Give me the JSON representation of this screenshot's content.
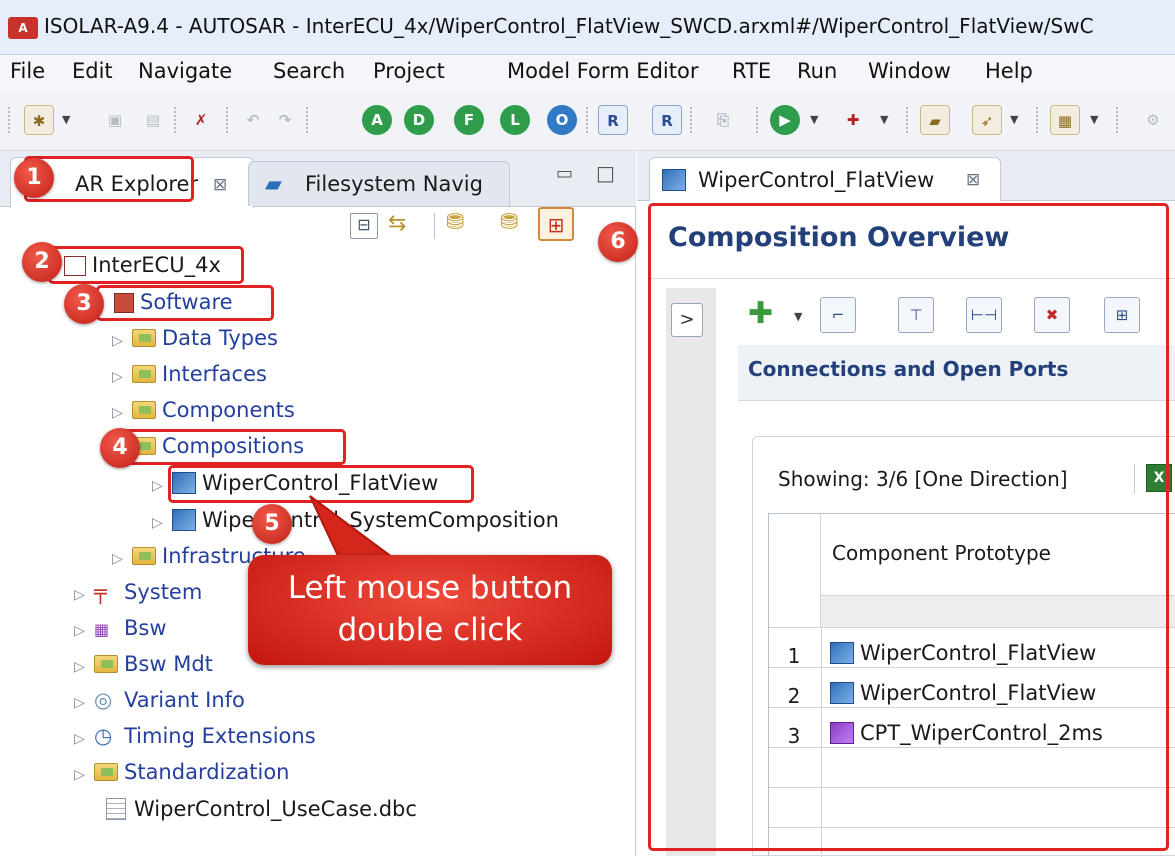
{
  "window": {
    "title": "ISOLAR-A9.4 - AUTOSAR - InterECU_4x/WiperControl_FlatView_SWCD.arxml#/WiperControl_FlatView/SwC",
    "app_icon_label": "A"
  },
  "menu": [
    "File",
    "Edit",
    "Navigate",
    "Search",
    "Project",
    "Model Form Editor",
    "RTE",
    "Run",
    "Window",
    "Help"
  ],
  "toolbar": {
    "circle_buttons": [
      "A",
      "D",
      "F",
      "L",
      "O"
    ]
  },
  "left_panel": {
    "tabs": [
      {
        "label": "AR Explorer",
        "close": "⊠"
      },
      {
        "label": "Filesystem Navig"
      }
    ],
    "minimize": "▭",
    "maximize": "□"
  },
  "tree": [
    {
      "label": "InterECU_4x"
    },
    {
      "label": "Software"
    },
    {
      "label": "Data Types"
    },
    {
      "label": "Interfaces"
    },
    {
      "label": "Components"
    },
    {
      "label": "Compositions"
    },
    {
      "label": "WiperControl_FlatView"
    },
    {
      "label": "WiperControl_SystemComposition"
    },
    {
      "label": "Infrastructure"
    },
    {
      "label": "System"
    },
    {
      "label": "Bsw"
    },
    {
      "label": "Bsw Mdt"
    },
    {
      "label": "Variant Info"
    },
    {
      "label": "Timing Extensions"
    },
    {
      "label": "Standardization"
    },
    {
      "label": "WiperControl_UseCase.dbc"
    }
  ],
  "editor": {
    "tab_label": "WiperControl_FlatView",
    "tab_close": "⊠",
    "overview_title": "Composition Overview",
    "collapse_label": ">",
    "section_title": "Connections and Open Ports",
    "showing": "Showing: 3/6 [One Direction]",
    "column_header": "Component Prototype",
    "rows": [
      {
        "num": "1",
        "name": "WiperControl_FlatView"
      },
      {
        "num": "2",
        "name": "WiperControl_FlatView"
      },
      {
        "num": "3",
        "name": "CPT_WiperControl_2ms"
      }
    ]
  },
  "annotations": {
    "badges": [
      "1",
      "2",
      "3",
      "4",
      "5",
      "6"
    ],
    "callout": "Left mouse button double click",
    "accent": "#e02222"
  }
}
